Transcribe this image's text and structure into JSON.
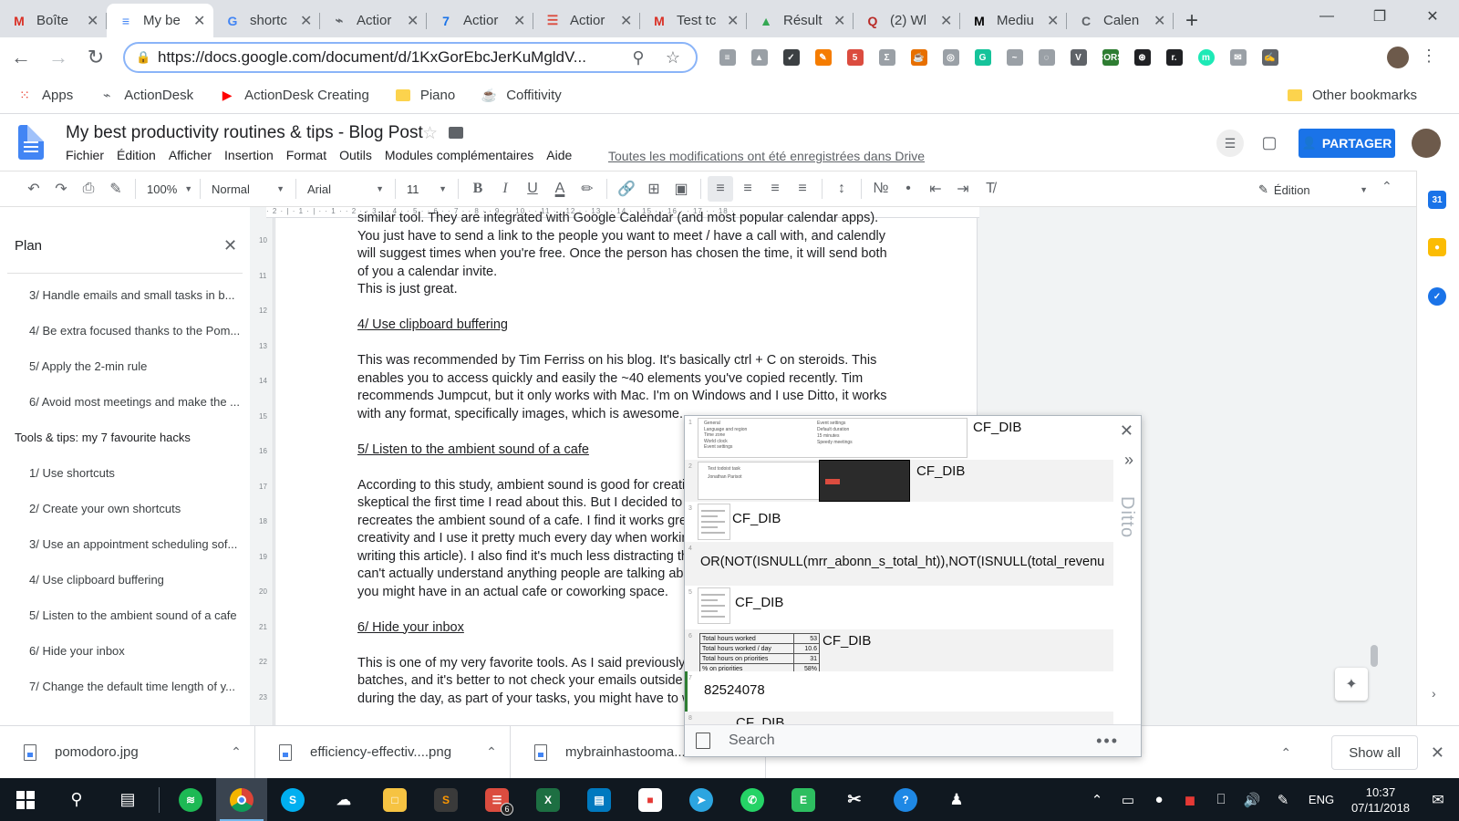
{
  "browser": {
    "tabs": [
      {
        "label": "Boîte",
        "icon": "gmail-icon",
        "color": "#d93025",
        "glyph": "M",
        "active": false
      },
      {
        "label": "My be",
        "icon": "docs-icon",
        "color": "#4285f4",
        "glyph": "≡",
        "active": true
      },
      {
        "label": "shortc",
        "icon": "google-icon",
        "color": "#4285f4",
        "glyph": "G",
        "active": false
      },
      {
        "label": "Actior",
        "icon": "actiondesk-icon",
        "color": "#5f6368",
        "glyph": "⌁",
        "active": false
      },
      {
        "label": "Actior",
        "icon": "calendar-icon",
        "color": "#1a73e8",
        "glyph": "7",
        "active": false
      },
      {
        "label": "Actior",
        "icon": "todoist-icon",
        "color": "#db4c3f",
        "glyph": "☰",
        "active": false
      },
      {
        "label": "Test tc",
        "icon": "gmail-icon",
        "color": "#d93025",
        "glyph": "M",
        "active": false
      },
      {
        "label": "Résult",
        "icon": "drive-icon",
        "color": "#34a853",
        "glyph": "▲",
        "active": false
      },
      {
        "label": "(2) Wl",
        "icon": "quora-icon",
        "color": "#b92b27",
        "glyph": "Q",
        "active": false
      },
      {
        "label": "Mediu",
        "icon": "medium-icon",
        "color": "#000000",
        "glyph": "M",
        "active": false
      },
      {
        "label": "Calen",
        "icon": "calendly-icon",
        "color": "#5f6368",
        "glyph": "C",
        "active": false
      }
    ],
    "url": "https://docs.google.com/document/d/1KxGorEbcJerKuMgldV...",
    "bookmarks": [
      {
        "label": "Apps",
        "icon": "apps-grid-icon"
      },
      {
        "label": "ActionDesk",
        "icon": "actiondesk-icon"
      },
      {
        "label": "ActionDesk Creating",
        "icon": "youtube-icon"
      },
      {
        "label": "Piano",
        "icon": "folder-icon"
      },
      {
        "label": "Coffitivity",
        "icon": "coffitivity-icon"
      }
    ],
    "other_bookmarks": "Other bookmarks"
  },
  "docs": {
    "title": "My best productivity routines & tips - Blog Post",
    "menu": [
      "Fichier",
      "Édition",
      "Afficher",
      "Insertion",
      "Format",
      "Outils",
      "Modules complémentaires",
      "Aide"
    ],
    "saved_note": "Toutes les modifications ont été enregistrées dans Drive",
    "share_label": "PARTAGER",
    "toolbar": {
      "zoom": "100%",
      "style": "Normal",
      "font": "Arial",
      "size": "11",
      "mode": "Édition"
    },
    "outline": {
      "title": "Plan",
      "items": [
        {
          "label": "3/ Handle emails and small tasks in b...",
          "level": 2
        },
        {
          "label": "4/ Be extra focused thanks to the Pom...",
          "level": 2
        },
        {
          "label": "5/ Apply the 2-min rule",
          "level": 2
        },
        {
          "label": "6/ Avoid most meetings and make the ...",
          "level": 2
        },
        {
          "label": "Tools & tips: my 7 favourite hacks",
          "level": 1
        },
        {
          "label": "1/ Use shortcuts",
          "level": 2
        },
        {
          "label": "2/ Create your own shortcuts",
          "level": 2
        },
        {
          "label": "3/ Use an appointment scheduling sof...",
          "level": 2
        },
        {
          "label": "4/ Use clipboard buffering",
          "level": 2
        },
        {
          "label": "5/ Listen to the ambient sound of a cafe",
          "level": 2
        },
        {
          "label": "6/ Hide your inbox",
          "level": 2
        },
        {
          "label": "7/ Change the default time length of y...",
          "level": 2
        }
      ]
    },
    "body": {
      "para1": [
        "similar tool. They are integrated with Google Calendar (and most popular calendar apps).",
        "You just have to send a link to the people you want to meet / have a call with, and calendly",
        "will suggest times when you're free. Once the person has chosen the time, it will send both",
        "of you a calendar invite.",
        "This is just great."
      ],
      "heading4": "4/ Use clipboard buffering",
      "para2": [
        "This was recommended by Tim Ferriss on his blog. It's basically ctrl + C on steroids. This",
        "enables you to access quickly and easily the ~40 elements you've copied recently. Tim",
        "recommends Jumpcut, but it only works with Mac. I'm on Windows and I use Ditto, it works",
        "with any format, specifically images, which is awesome."
      ],
      "heading5": "5/ Listen to the ambient sound of a cafe",
      "para3": [
        "According to this study, ambient sound is good for creativ",
        "skeptical the first time I read about this. But I decided to g",
        "recreates the ambient sound of a cafe. I find it works grea",
        "creativity and I use it pretty much every day when working",
        "writing this article). I also find it's much less distracting tha",
        "can't actually understand anything people are talking abo",
        "you might have in an actual cafe or coworking space."
      ],
      "heading6": "6/ Hide your inbox",
      "para4": [
        "This is one of my very favorite tools. As I said previously,",
        "batches, and it's better to not check your emails outside o",
        "during the day, as part of your tasks, you might have to w"
      ]
    }
  },
  "ditto": {
    "brand": "Ditto",
    "search_placeholder": "Search",
    "clips": [
      {
        "num": "1",
        "label": "CF_DIB",
        "thumb_lines": [
          "General",
          "Language and region",
          "Time zone",
          "World clock",
          "Event settings"
        ],
        "thumb_right": [
          "Event settings",
          "Default duration",
          "15 minutes",
          "Speedy meetings"
        ]
      },
      {
        "num": "2",
        "label": "CF_DIB",
        "thumb_lines": [
          "Test todoist task",
          "Jonathan Parisot"
        ]
      },
      {
        "num": "3",
        "label": "CF_DIB"
      },
      {
        "num": "4",
        "label": "OR(NOT(ISNULL(mrr_abonn_s_total_ht)),NOT(ISNULL(total_revenu"
      },
      {
        "num": "5",
        "label": "CF_DIB"
      },
      {
        "num": "6",
        "label": "CF_DIB",
        "table": [
          [
            "Total hours worked",
            "53"
          ],
          [
            "Total hours worked / day",
            "10.6"
          ],
          [
            "Total hours on priorities",
            "31"
          ],
          [
            "% on priorities",
            "58%"
          ]
        ]
      },
      {
        "num": "7",
        "label": "82524078"
      },
      {
        "num": "8",
        "label": "CF_DIB"
      }
    ]
  },
  "downloads": {
    "items": [
      "pomodoro.jpg",
      "efficiency-effectiv....png",
      "mybrainhastooma..."
    ],
    "show_all": "Show all"
  },
  "taskbar": {
    "language": "ENG",
    "time": "10:37",
    "date": "07/11/2018",
    "badges": {
      "todoist": "6",
      "calendar_ext": "5"
    }
  },
  "colors": {
    "share_blue": "#1a73e8",
    "docs_blue": "#4285f4",
    "taskbar_bg": "#101820",
    "ditto_green": "#2e7d32"
  }
}
